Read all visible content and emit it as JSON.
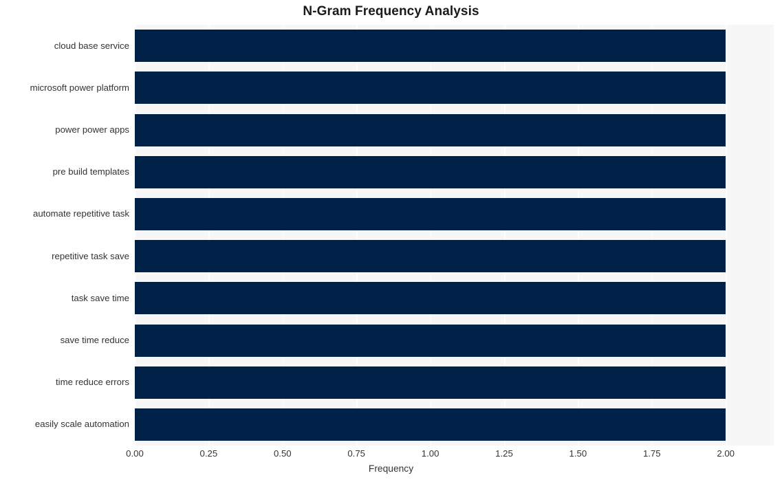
{
  "chart_data": {
    "type": "bar",
    "orientation": "horizontal",
    "title": "N-Gram Frequency Analysis",
    "xlabel": "Frequency",
    "ylabel": "",
    "categories": [
      "cloud base service",
      "microsoft power platform",
      "power power apps",
      "pre build templates",
      "automate repetitive task",
      "repetitive task save",
      "task save time",
      "save time reduce",
      "time reduce errors",
      "easily scale automation"
    ],
    "values": [
      2,
      2,
      2,
      2,
      2,
      2,
      2,
      2,
      2,
      2
    ],
    "xlim": [
      0.0,
      2.1625
    ],
    "xticks": [
      0.0,
      0.25,
      0.5,
      0.75,
      1.0,
      1.25,
      1.5,
      1.75,
      2.0
    ],
    "xtick_labels": [
      "0.00",
      "0.25",
      "0.50",
      "0.75",
      "1.00",
      "1.25",
      "1.50",
      "1.75",
      "2.00"
    ],
    "grid": true,
    "grid_axis": "x",
    "legend": null,
    "colors": {
      "bar": "#002147",
      "plot_background": "#f7f7f7",
      "figure_background": "#ffffff",
      "gridline": "#fdfdfd",
      "tick_label": "#333333",
      "title": "#1a1a1a"
    }
  }
}
